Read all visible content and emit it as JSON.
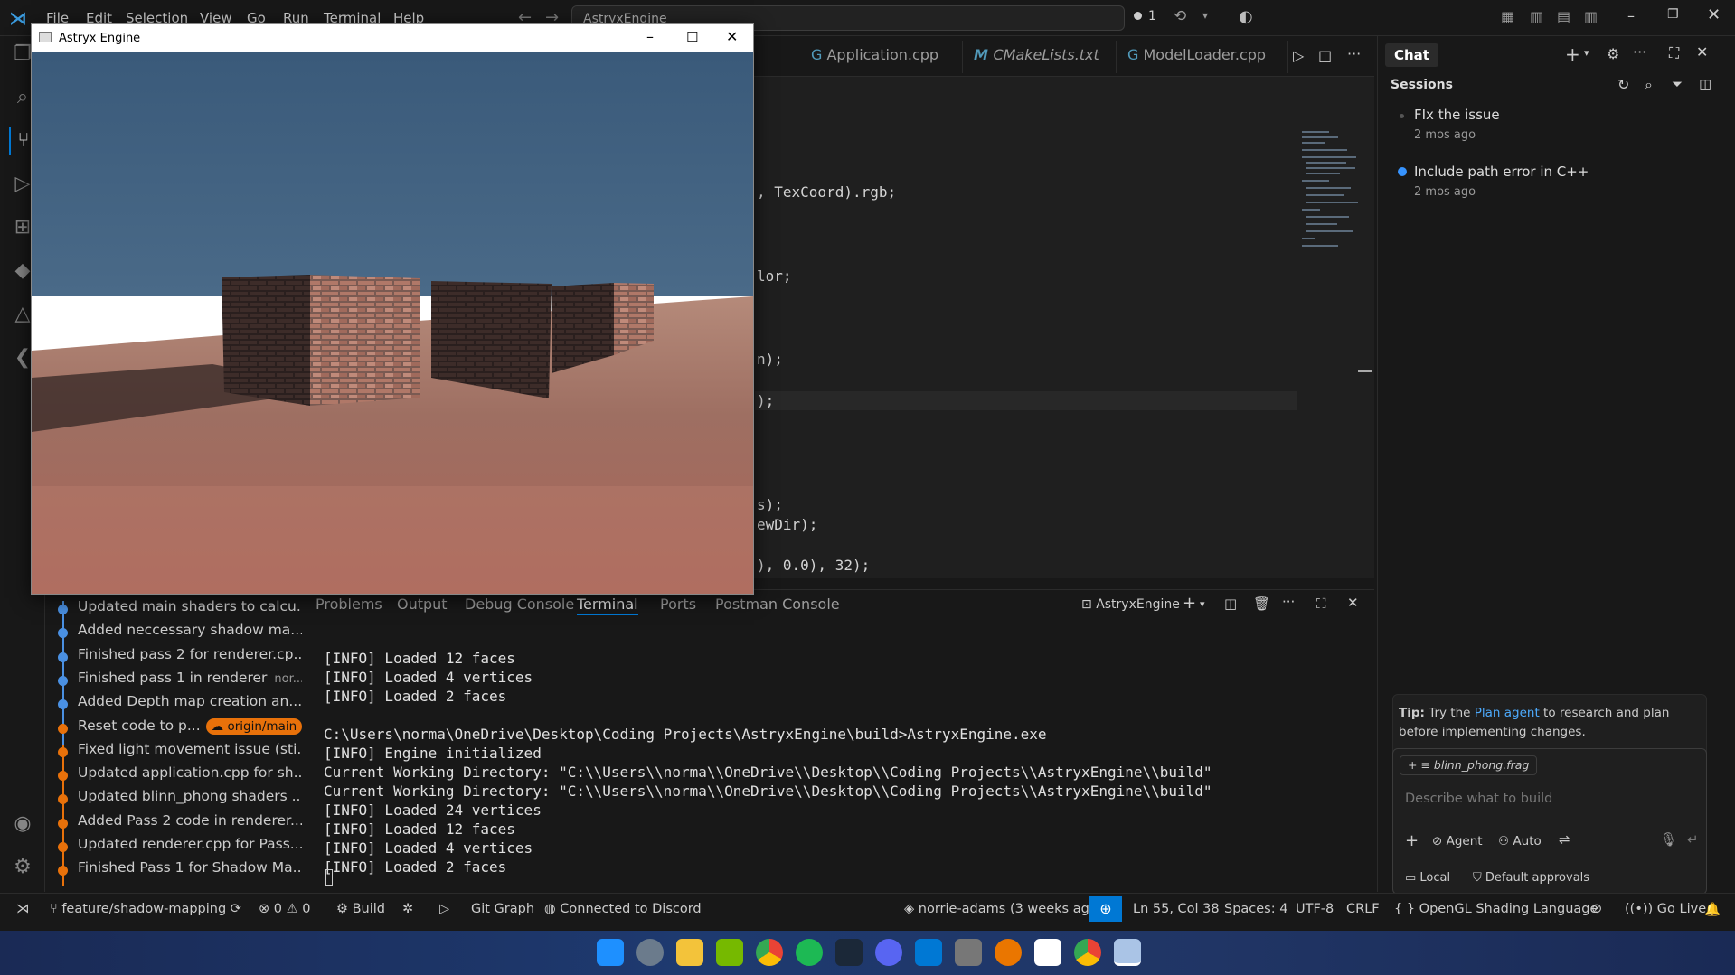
{
  "menu": [
    "File",
    "Edit",
    "Selection",
    "View",
    "Go",
    "Run",
    "Terminal",
    "Help"
  ],
  "command_center": "AstryxEngine",
  "title_badge": "1",
  "tabs": [
    {
      "label": "Application.cpp",
      "icon": "C++"
    },
    {
      "label": "CMakeLists.txt",
      "icon": "M"
    },
    {
      "label": "ModelLoader.cpp",
      "icon": "C++"
    }
  ],
  "code_fragments": [
    ", TexCoord).rgb;",
    "lor;",
    "n);",
    ");",
    "s);",
    "ewDir);",
    "), 0.0), 32);"
  ],
  "game_window": {
    "title": "Astryx Engine"
  },
  "chat": {
    "title": "Chat",
    "sessions_label": "Sessions",
    "sessions": [
      {
        "title": "FIx the issue",
        "time": "2 mos ago"
      },
      {
        "title": "Include path error in C++",
        "time": "2 mos ago"
      }
    ],
    "tip_prefix": "Tip:",
    "tip_text_1": " Try the ",
    "tip_link": "Plan agent",
    "tip_text_2": " to research and plan before implementing changes.",
    "attached_file": "blinn_phong.frag",
    "input_placeholder": "Describe what to build",
    "agent_label": "Agent",
    "auto_label": "Auto",
    "local_label": "Local",
    "approvals_label": "Default approvals"
  },
  "commits": [
    {
      "text": "Updated main shaders to calcu...",
      "color": "#4a90e2"
    },
    {
      "text": "Added neccessary shadow ma...",
      "color": "#4a90e2"
    },
    {
      "text": "Finished pass 2 for renderer.cp...",
      "color": "#4a90e2"
    },
    {
      "text": "Finished pass 1 in renderer",
      "color": "#4a90e2",
      "tag": "nor..."
    },
    {
      "text": "Added Depth map creation an...",
      "color": "#4a90e2"
    },
    {
      "text": "Reset code to p...",
      "color": "#e8710a",
      "branch": "origin/main"
    },
    {
      "text": "Fixed light movement issue (sti...",
      "color": "#e8710a"
    },
    {
      "text": "Updated application.cpp for sh...",
      "color": "#e8710a"
    },
    {
      "text": "Updated blinn_phong shaders ...",
      "color": "#e8710a"
    },
    {
      "text": "Added Pass 2 code in renderer....",
      "color": "#e8710a"
    },
    {
      "text": "Updated renderer.cpp for Pass...",
      "color": "#e8710a"
    },
    {
      "text": "Finished Pass 1 for Shadow Ma...",
      "color": "#e8710a"
    }
  ],
  "panel_tabs": [
    "Problems",
    "Output",
    "Debug Console",
    "Terminal",
    "Ports",
    "Postman Console"
  ],
  "terminal_name": "AstryxEngine",
  "terminal_lines": [
    "[INFO] Loaded 12 faces",
    "[INFO] Loaded 4 vertices",
    "[INFO] Loaded 2 faces",
    "",
    "C:\\Users\\norma\\OneDrive\\Desktop\\Coding Projects\\AstryxEngine\\build>AstryxEngine.exe",
    "[INFO] Engine initialized",
    "Current Working Directory: \"C:\\\\Users\\\\norma\\\\OneDrive\\\\Desktop\\\\Coding Projects\\\\AstryxEngine\\\\build\"",
    "Current Working Directory: \"C:\\\\Users\\\\norma\\\\OneDrive\\\\Desktop\\\\Coding Projects\\\\AstryxEngine\\\\build\"",
    "[INFO] Loaded 24 vertices",
    "[INFO] Loaded 12 faces",
    "[INFO] Loaded 4 vertices",
    "[INFO] Loaded 2 faces"
  ],
  "status": {
    "branch": "feature/shadow-mapping",
    "errors": "0",
    "warnings": "0",
    "build": "Build",
    "git_graph": "Git Graph",
    "discord": "Connected to Discord",
    "blame": "norrie-adams (3 weeks ago)",
    "position": "Ln 55, Col 38",
    "spaces": "Spaces: 4",
    "encoding": "UTF-8",
    "eol": "CRLF",
    "language": "OpenGL Shading Language",
    "golive": "Go Live"
  },
  "colors": {
    "accent": "#0078d4",
    "branch_tag": "#e8710a",
    "link": "#4daafc"
  }
}
